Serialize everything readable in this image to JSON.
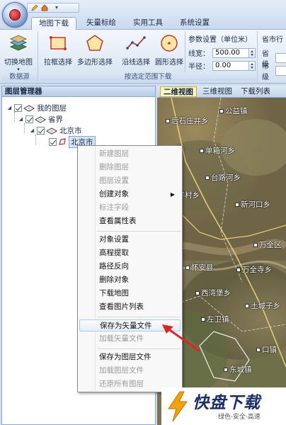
{
  "tabs": [
    "地图下载",
    "矢量标绘",
    "实用工具",
    "系统设置"
  ],
  "ribbon": {
    "data_source_group": {
      "label": "数据源",
      "switch_map": "切换地图"
    },
    "range_group": {
      "label": "按选定范围下载",
      "buttons": [
        "拉框选择",
        "多边形选择",
        "沿线选择",
        "圆形选择"
      ]
    },
    "params": {
      "title": "参数设置（单位米）",
      "line_width_label": "线宽：",
      "line_width_value": "500.00",
      "radius_label": "半径：",
      "radius_value": "0.00"
    },
    "city": {
      "title": "省市行",
      "province_label": "省级",
      "city_label": "市级"
    }
  },
  "layer_panel": {
    "title": "图层管理器",
    "nodes": [
      "我的图层",
      "省界",
      "北京市",
      "北京市"
    ]
  },
  "map": {
    "tabs": [
      "二维视图",
      "三维视图",
      "下载列表"
    ],
    "places": [
      "公益镇",
      "后石庄井乡",
      "单箱河乡",
      "台路河乡",
      "和平村乡",
      "新河口乡",
      "万全区",
      "怀安县",
      "万全寺乡",
      "西湾堡乡",
      "土城子乡",
      "左卫镇",
      "东城镇",
      "口镇"
    ]
  },
  "context_menu": {
    "items": [
      "新建图层",
      "删除图层",
      "图层设置",
      "创建对象",
      "标注字段",
      "查看属性表",
      "对象设置",
      "高程提取",
      "路径反向",
      "删除对象",
      "下载地图",
      "查看图片列表",
      "保存为矢量文件",
      "加载矢量文件",
      "保存为图层文件",
      "加载图层文件",
      "还原所有图层"
    ]
  },
  "watermark": {
    "title": "快盘下载",
    "subtitle": "绿色·安全·高速"
  }
}
